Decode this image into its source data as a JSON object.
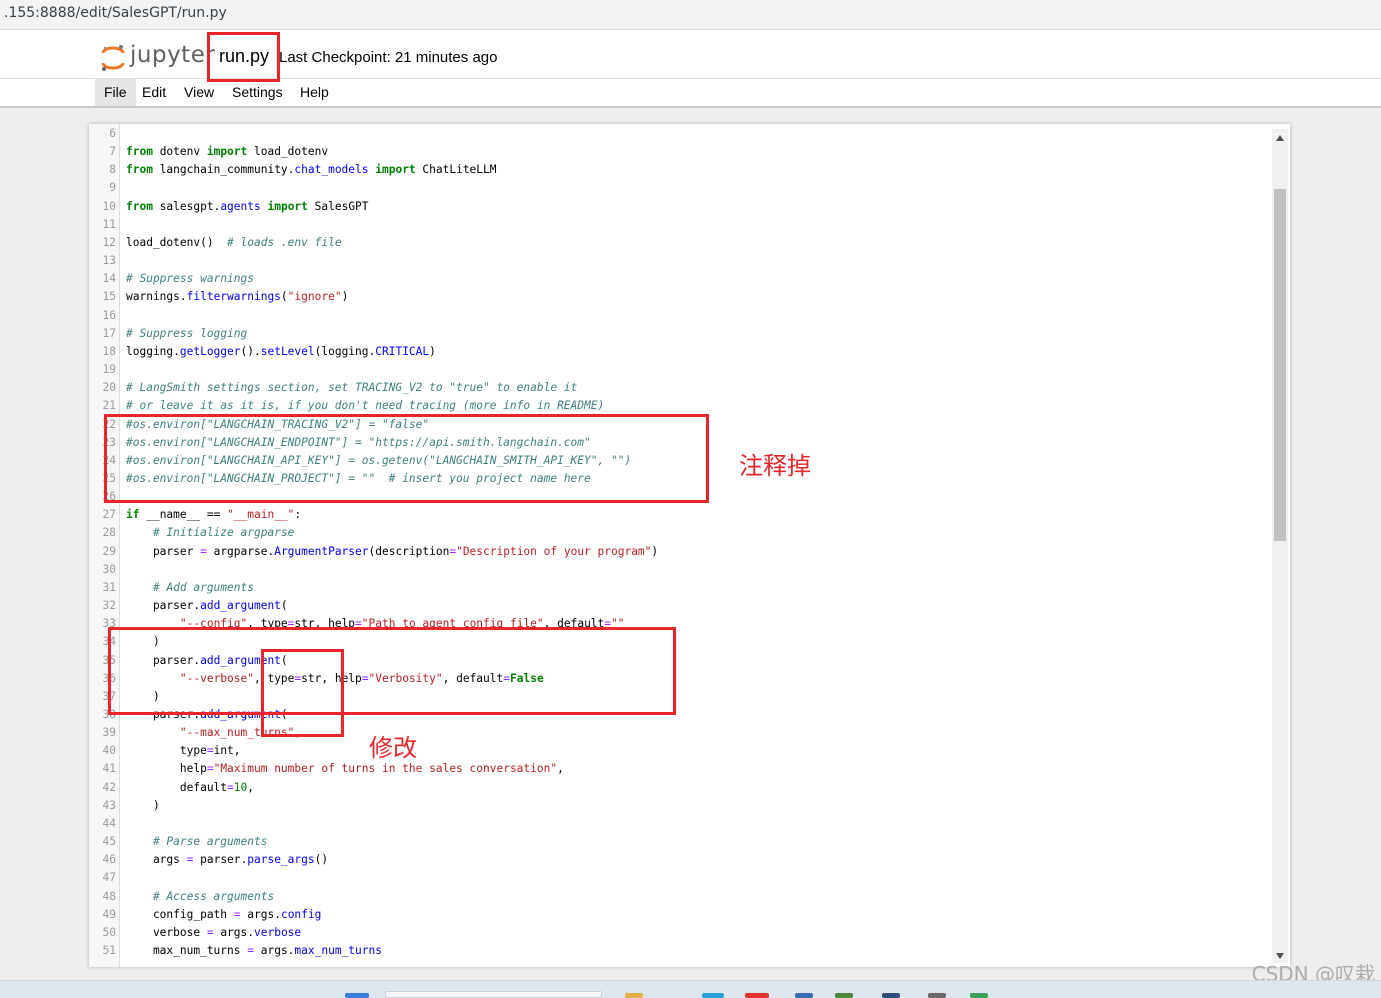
{
  "browser": {
    "url": ".155:8888/edit/SalesGPT/run.py"
  },
  "header": {
    "logo_text": "jupyter",
    "filename": "run.py",
    "checkpoint": "Last Checkpoint: 21 minutes ago"
  },
  "menu": [
    {
      "label": "File"
    },
    {
      "label": "Edit"
    },
    {
      "label": "View"
    },
    {
      "label": "Settings"
    },
    {
      "label": "Help"
    }
  ],
  "annotations": {
    "comment_out": "注释掉",
    "modify": "修改"
  },
  "watermark": "CSDN @叹栽",
  "code_lines": [
    {
      "n": "6",
      "t": ""
    },
    {
      "n": "7",
      "t": "from dotenv import load_dotenv"
    },
    {
      "n": "8",
      "t": "from langchain_community.chat_models import ChatLiteLLM"
    },
    {
      "n": "9",
      "t": ""
    },
    {
      "n": "10",
      "t": "from salesgpt.agents import SalesGPT"
    },
    {
      "n": "11",
      "t": ""
    },
    {
      "n": "12",
      "t": "load_dotenv()  # loads .env file"
    },
    {
      "n": "13",
      "t": ""
    },
    {
      "n": "14",
      "t": "# Suppress warnings"
    },
    {
      "n": "15",
      "t": "warnings.filterwarnings(\"ignore\")"
    },
    {
      "n": "16",
      "t": ""
    },
    {
      "n": "17",
      "t": "# Suppress logging"
    },
    {
      "n": "18",
      "t": "logging.getLogger().setLevel(logging.CRITICAL)"
    },
    {
      "n": "19",
      "t": ""
    },
    {
      "n": "20",
      "t": "# LangSmith settings section, set TRACING_V2 to \"true\" to enable it"
    },
    {
      "n": "21",
      "t": "# or leave it as it is, if you don't need tracing (more info in README)"
    },
    {
      "n": "22",
      "t": "#os.environ[\"LANGCHAIN_TRACING_V2\"] = \"false\""
    },
    {
      "n": "23",
      "t": "#os.environ[\"LANGCHAIN_ENDPOINT\"] = \"https://api.smith.langchain.com\""
    },
    {
      "n": "24",
      "t": "#os.environ[\"LANGCHAIN_API_KEY\"] = os.getenv(\"LANGCHAIN_SMITH_API_KEY\", \"\")"
    },
    {
      "n": "25",
      "t": "#os.environ[\"LANGCHAIN_PROJECT\"] = \"\"  # insert you project name here"
    },
    {
      "n": "26",
      "t": ""
    },
    {
      "n": "27",
      "t": "if __name__ == \"__main__\":"
    },
    {
      "n": "28",
      "t": "    # Initialize argparse"
    },
    {
      "n": "29",
      "t": "    parser = argparse.ArgumentParser(description=\"Description of your program\")"
    },
    {
      "n": "30",
      "t": ""
    },
    {
      "n": "31",
      "t": "    # Add arguments"
    },
    {
      "n": "32",
      "t": "    parser.add_argument("
    },
    {
      "n": "33",
      "t": "        \"--config\", type=str, help=\"Path to agent config file\", default=\"\""
    },
    {
      "n": "34",
      "t": "    )"
    },
    {
      "n": "35",
      "t": "    parser.add_argument("
    },
    {
      "n": "36",
      "t": "        \"--verbose\", type=str, help=\"Verbosity\", default=False"
    },
    {
      "n": "37",
      "t": "    )"
    },
    {
      "n": "38",
      "t": "    parser.add_argument("
    },
    {
      "n": "39",
      "t": "        \"--max_num_turns\","
    },
    {
      "n": "40",
      "t": "        type=int,"
    },
    {
      "n": "41",
      "t": "        help=\"Maximum number of turns in the sales conversation\","
    },
    {
      "n": "42",
      "t": "        default=10,"
    },
    {
      "n": "43",
      "t": "    )"
    },
    {
      "n": "44",
      "t": ""
    },
    {
      "n": "45",
      "t": "    # Parse arguments"
    },
    {
      "n": "46",
      "t": "    args = parser.parse_args()"
    },
    {
      "n": "47",
      "t": ""
    },
    {
      "n": "48",
      "t": "    # Access arguments"
    },
    {
      "n": "49",
      "t": "    config_path = args.config"
    },
    {
      "n": "50",
      "t": "    verbose = args.verbose"
    },
    {
      "n": "51",
      "t": "    max_num_turns = args.max_num_turns"
    }
  ]
}
